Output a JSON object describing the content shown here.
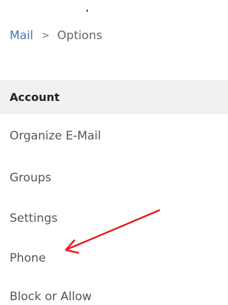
{
  "breadcrumb": {
    "root": "Mail",
    "separator": ">",
    "current": "Options"
  },
  "section": {
    "title": "Account"
  },
  "menu": {
    "items": [
      "Organize E-Mail",
      "Groups",
      "Settings",
      "Phone",
      "Block or Allow"
    ]
  },
  "colors": {
    "link": "#3c76c0",
    "header_bg": "#f1f1f1",
    "annotation_arrow": "#e8141c"
  }
}
